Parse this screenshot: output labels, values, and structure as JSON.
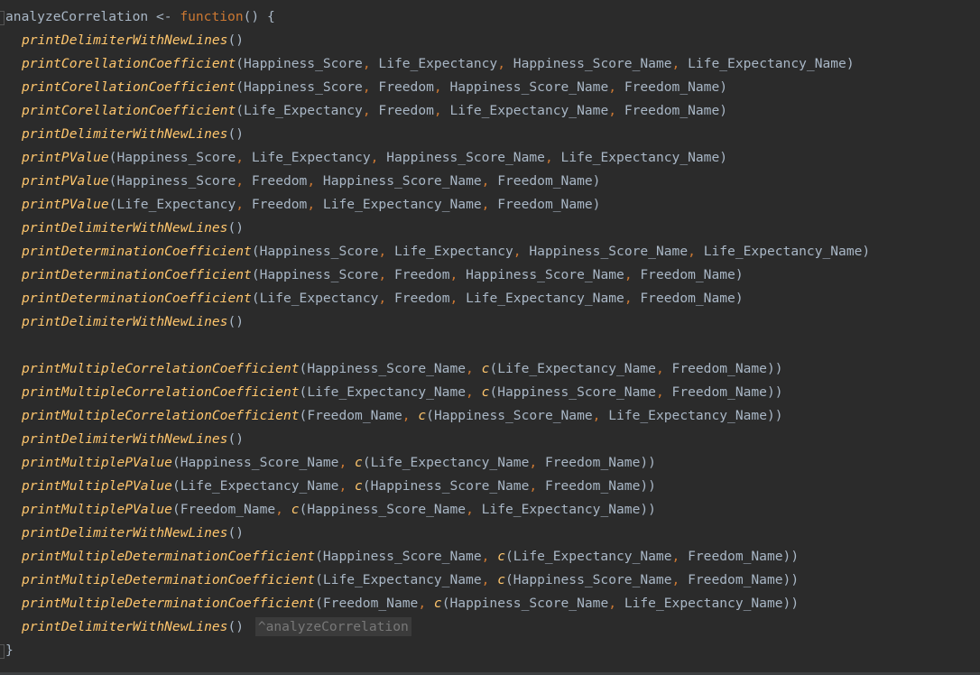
{
  "header": {
    "name": "analyzeCorrelation",
    "assign": "<-",
    "keyword": "function",
    "open": "() {"
  },
  "lines": [
    {
      "fn": "printDelimiterWithNewLines",
      "args": "()"
    },
    {
      "fn": "printCorellationCoefficient",
      "args": "(Happiness_Score, Life_Expectancy, Happiness_Score_Name, Life_Expectancy_Name)"
    },
    {
      "fn": "printCorellationCoefficient",
      "args": "(Happiness_Score, Freedom, Happiness_Score_Name, Freedom_Name)"
    },
    {
      "fn": "printCorellationCoefficient",
      "args": "(Life_Expectancy, Freedom, Life_Expectancy_Name, Freedom_Name)"
    },
    {
      "fn": "printDelimiterWithNewLines",
      "args": "()"
    },
    {
      "fn": "printPValue",
      "args": "(Happiness_Score, Life_Expectancy, Happiness_Score_Name, Life_Expectancy_Name)"
    },
    {
      "fn": "printPValue",
      "args": "(Happiness_Score, Freedom, Happiness_Score_Name, Freedom_Name)"
    },
    {
      "fn": "printPValue",
      "args": "(Life_Expectancy, Freedom, Life_Expectancy_Name, Freedom_Name)"
    },
    {
      "fn": "printDelimiterWithNewLines",
      "args": "()"
    },
    {
      "fn": "printDeterminationCoefficient",
      "args": "(Happiness_Score, Life_Expectancy, Happiness_Score_Name, Life_Expectancy_Name)"
    },
    {
      "fn": "printDeterminationCoefficient",
      "args": "(Happiness_Score, Freedom, Happiness_Score_Name, Freedom_Name)"
    },
    {
      "fn": "printDeterminationCoefficient",
      "args": "(Life_Expectancy, Freedom, Life_Expectancy_Name, Freedom_Name)"
    },
    {
      "fn": "printDelimiterWithNewLines",
      "args": "()"
    },
    {
      "fn": "",
      "args": ""
    },
    {
      "fn": "printMultipleCorrelationCoefficient",
      "args": "(Happiness_Score_Name, c(Life_Expectancy_Name, Freedom_Name))"
    },
    {
      "fn": "printMultipleCorrelationCoefficient",
      "args": "(Life_Expectancy_Name, c(Happiness_Score_Name, Freedom_Name))"
    },
    {
      "fn": "printMultipleCorrelationCoefficient",
      "args": "(Freedom_Name, c(Happiness_Score_Name, Life_Expectancy_Name))"
    },
    {
      "fn": "printDelimiterWithNewLines",
      "args": "()"
    },
    {
      "fn": "printMultiplePValue",
      "args": "(Happiness_Score_Name, c(Life_Expectancy_Name, Freedom_Name))"
    },
    {
      "fn": "printMultiplePValue",
      "args": "(Life_Expectancy_Name, c(Happiness_Score_Name, Freedom_Name))"
    },
    {
      "fn": "printMultiplePValue",
      "args": "(Freedom_Name, c(Happiness_Score_Name, Life_Expectancy_Name))"
    },
    {
      "fn": "printDelimiterWithNewLines",
      "args": "()"
    },
    {
      "fn": "printMultipleDeterminationCoefficient",
      "args": "(Happiness_Score_Name, c(Life_Expectancy_Name, Freedom_Name))"
    },
    {
      "fn": "printMultipleDeterminationCoefficient",
      "args": "(Life_Expectancy_Name, c(Happiness_Score_Name, Freedom_Name))"
    },
    {
      "fn": "printMultipleDeterminationCoefficient",
      "args": "(Freedom_Name, c(Happiness_Score_Name, Life_Expectancy_Name))"
    },
    {
      "fn": "printDelimiterWithNewLines",
      "args": "()",
      "hint": "^analyzeCorrelation"
    }
  ],
  "closing": "}",
  "colors": {
    "background": "#2b2b2b",
    "function_name": "#ffc66d",
    "keyword": "#cc7832",
    "text": "#a9b7c6",
    "hint": "#787878"
  }
}
